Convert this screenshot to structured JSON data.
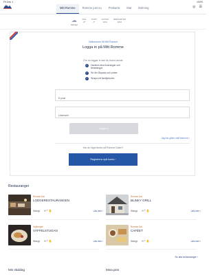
{
  "status_bar": {
    "time": "Fri Dec 1",
    "battery": "100%"
  },
  "nav": {
    "tabs": [
      {
        "label": "Mitt Romme"
      },
      {
        "label": "Romme just nu"
      },
      {
        "label": "Priskarta"
      },
      {
        "label": "Mat"
      },
      {
        "label": "Bokning"
      }
    ],
    "active_index": 0
  },
  "weather": {
    "condition_label": "Molnigt",
    "readings": [
      {
        "label": "DAL",
        "value": "-6°"
      },
      {
        "label": "TOPP",
        "value": "-7°"
      },
      {
        "label": "LIFTAR",
        "value": "0/14"
      },
      {
        "label": "NEDFARTER",
        "value": "0/14"
      }
    ]
  },
  "login": {
    "eyebrow": "Välkommen till Mitt Romme",
    "title": "Logga in på Mitt Romme",
    "subtitle": "Om du loggar in kan du bland annat:",
    "benefits": [
      "Hantera dina bokningar och betalningar",
      "Se din Åkpass och priser",
      "Skapa ett familjekonto"
    ],
    "email_placeholder": "E-post",
    "password_placeholder": "Lösenord",
    "login_button": "Logga in",
    "forgot_link": "Jag har glömt mitt lösenord ›",
    "no_account_text": "Har du inget konto på Romme Dalen?",
    "register_button": "Registrera nytt konto ›"
  },
  "restaurants": {
    "heading": "Restauranger",
    "items": [
      {
        "area": "Romme Dal",
        "name": "LODGERESTAURANGEN",
        "status": "Stängt",
        "more": "Läs mer ›"
      },
      {
        "area": "Romme Dal",
        "name": "BLINKY GRILL",
        "status": "Stängt",
        "more": "Läs mer ›"
      },
      {
        "area": "Gräberget",
        "name": "VÄFFELSTUGAN",
        "status": "Stängt",
        "more": "Läs mer ›"
      },
      {
        "area": "Romme Dal",
        "name": "CAFÉET",
        "status": "Stängt",
        "more": "Läs mer ›"
      }
    ],
    "all_link": "Se alla restauranger ›"
  },
  "footer": {
    "left": "Min skiddag",
    "right": "Mina pins"
  },
  "colors": {
    "primary": "#2657a6",
    "accent_red": "#d23a3a",
    "link": "#4a79c4"
  }
}
